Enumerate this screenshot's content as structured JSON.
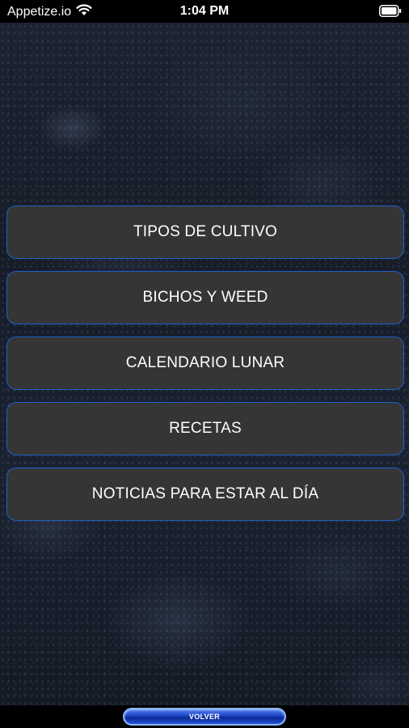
{
  "status_bar": {
    "carrier": "Appetize.io",
    "time": "1:04 PM",
    "icons": [
      "wifi-icon",
      "battery-icon"
    ]
  },
  "menu": {
    "items": [
      {
        "label": "TIPOS DE CULTIVO"
      },
      {
        "label": "BICHOS Y WEED"
      },
      {
        "label": "CALENDARIO LUNAR"
      },
      {
        "label": "RECETAS"
      },
      {
        "label": "NOTICIAS PARA ESTAR AL DÍA"
      }
    ]
  },
  "bottom_bar": {
    "back_label": "VOLVER"
  },
  "colors": {
    "button_background": "#353535",
    "button_border": "#1f5fc9",
    "back_button": "#1e44c4"
  }
}
